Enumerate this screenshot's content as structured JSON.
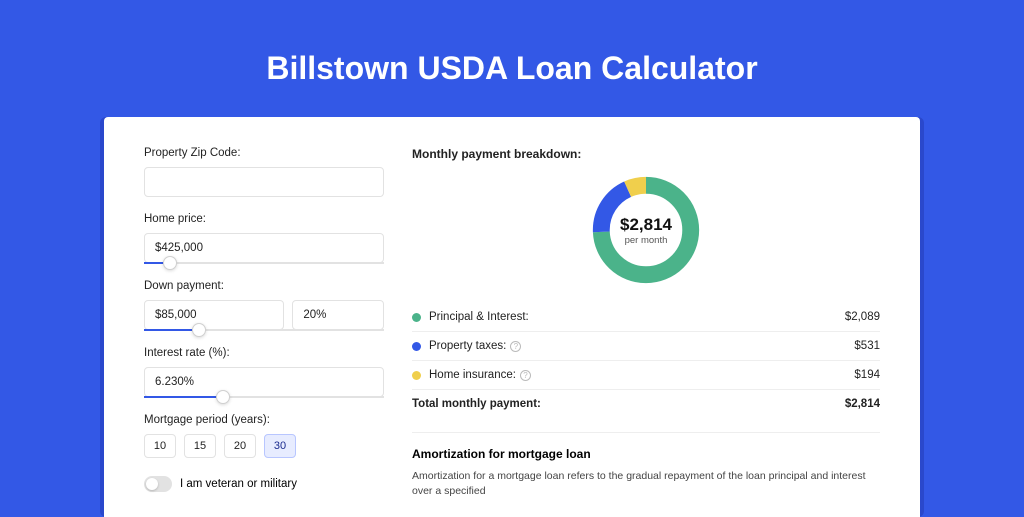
{
  "pageTitle": "Billstown USDA Loan Calculator",
  "form": {
    "zip": {
      "label": "Property Zip Code:",
      "value": ""
    },
    "homePrice": {
      "label": "Home price:",
      "value": "$425,000",
      "sliderPct": 8
    },
    "downPayment": {
      "label": "Down payment:",
      "amount": "$85,000",
      "percent": "20%",
      "sliderPct": 20
    },
    "interestRate": {
      "label": "Interest rate (%):",
      "value": "6.230%",
      "sliderPct": 30
    },
    "mortgagePeriod": {
      "label": "Mortgage period (years):",
      "options": [
        "10",
        "15",
        "20",
        "30"
      ],
      "selected": "30"
    },
    "veteran": {
      "label": "I am veteran or military",
      "checked": false
    }
  },
  "breakdown": {
    "title": "Monthly payment breakdown:",
    "centerAmount": "$2,814",
    "centerSub": "per month",
    "items": [
      {
        "label": "Principal & Interest:",
        "value": "$2,089",
        "color": "green",
        "info": false
      },
      {
        "label": "Property taxes:",
        "value": "$531",
        "color": "blue",
        "info": true
      },
      {
        "label": "Home insurance:",
        "value": "$194",
        "color": "yellow",
        "info": true
      }
    ],
    "totalLabel": "Total monthly payment:",
    "totalValue": "$2,814"
  },
  "chart_data": {
    "type": "pie",
    "title": "Monthly payment breakdown",
    "series": [
      {
        "name": "Principal & Interest",
        "value": 2089,
        "color": "#4bb38a"
      },
      {
        "name": "Property taxes",
        "value": 531,
        "color": "#3358e6"
      },
      {
        "name": "Home insurance",
        "value": 194,
        "color": "#f0cf4c"
      }
    ],
    "total": 2814
  },
  "amortization": {
    "title": "Amortization for mortgage loan",
    "text": "Amortization for a mortgage loan refers to the gradual repayment of the loan principal and interest over a specified"
  }
}
